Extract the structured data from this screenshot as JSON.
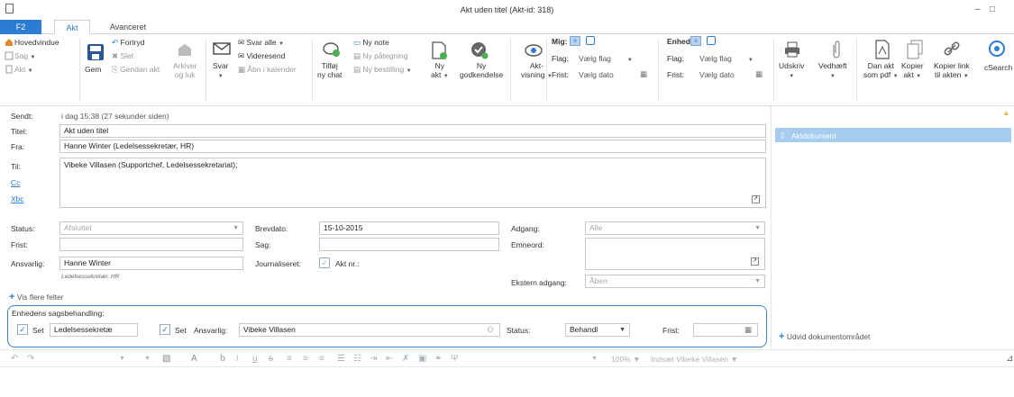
{
  "window": {
    "title": "Akt uden titel (Akt-id: 318)"
  },
  "tabs": {
    "f2": "F2",
    "akt": "Akt",
    "advanced": "Avanceret"
  },
  "ribbon": {
    "home": "Hovedvindue",
    "case": "Sag",
    "akt": "Akt",
    "save": "Gem",
    "redo": "Fortryd",
    "delete": "Slet",
    "save_close": "Gendan akt",
    "archive": "Arkiver",
    "archive2": "og luk",
    "reply": "Svar",
    "reply_all": "Svar alle",
    "forward": "Videresend",
    "open_calendar": "Åbn i kalender",
    "add_chat1": "Tilføj",
    "add_chat2": "ny chat",
    "new_note": "Ny note",
    "new_endorsement": "Ny påtegning",
    "new_order": "Ny bestilling",
    "new_akt1": "Ny",
    "new_akt2": "akt",
    "new_approval1": "Ny",
    "new_approval2": "godkendelse",
    "view1": "Akt-",
    "view2": "visning",
    "me": "Mig:",
    "unit": "Enhed:",
    "flag": "Flag:",
    "choose_flag": "Vælg flag",
    "deadline": "Frist:",
    "choose_date": "Vælg dato",
    "print": "Udskriv",
    "attach": "Vedhæft",
    "pdf1": "Dan akt",
    "pdf2": "som pdf",
    "copy1": "Kopier",
    "copy2": "akt",
    "copylink1": "Kopier link",
    "copylink2": "til akten",
    "csearch": "cSearch"
  },
  "form": {
    "sent_label": "Sendt:",
    "sent_value": "i dag 15:38 (27 sekunder siden)",
    "title_label": "Titel:",
    "title_value": "Akt uden titel",
    "from_label": "Fra:",
    "from_value": "Hanne Winter (Ledelsessekretær, HR)",
    "to_label": "Til:",
    "to_value": "Vibeke Villasen (Supportchef, Ledelsessekretariat);",
    "cc_label": "Cc",
    "bcc_label": "Xbc",
    "status_label": "Status:",
    "status_value": "Afsluttet",
    "deadline_label": "Frist:",
    "responsible_label": "Ansvarlig:",
    "responsible_value": "Hanne Winter",
    "responsible_sub": "Ledelsessekretær, HR",
    "letterdate_label": "Brevdato:",
    "letterdate_value": "15-10-2015",
    "case_label": "Sag:",
    "journal_label": "Journaliseret:",
    "aktnr_label": "Akt nr.:",
    "access_label": "Adgang:",
    "access_value": "Alle",
    "keywords_label": "Emneord:",
    "ext_access_label": "Ekstern adgang:",
    "ext_access_value": "Åben",
    "more_fields": "Vis flere felter"
  },
  "casework": {
    "title": "Enhedens sagsbehandling:",
    "set1": "Set",
    "unit_value": "Ledelsessekretæ",
    "set2": "Set",
    "responsible_label": "Ansvarlig:",
    "responsible_value": "Vibeke Villasen",
    "status_label": "Status:",
    "status_value": "Behandl",
    "deadline_label": "Frist:"
  },
  "right": {
    "doc_item": "Aktdokument",
    "expand": "Udvid dokumentområdet"
  },
  "editor": {
    "zoom": "100%",
    "insert": "Indsæt Vibeke Villasen"
  }
}
